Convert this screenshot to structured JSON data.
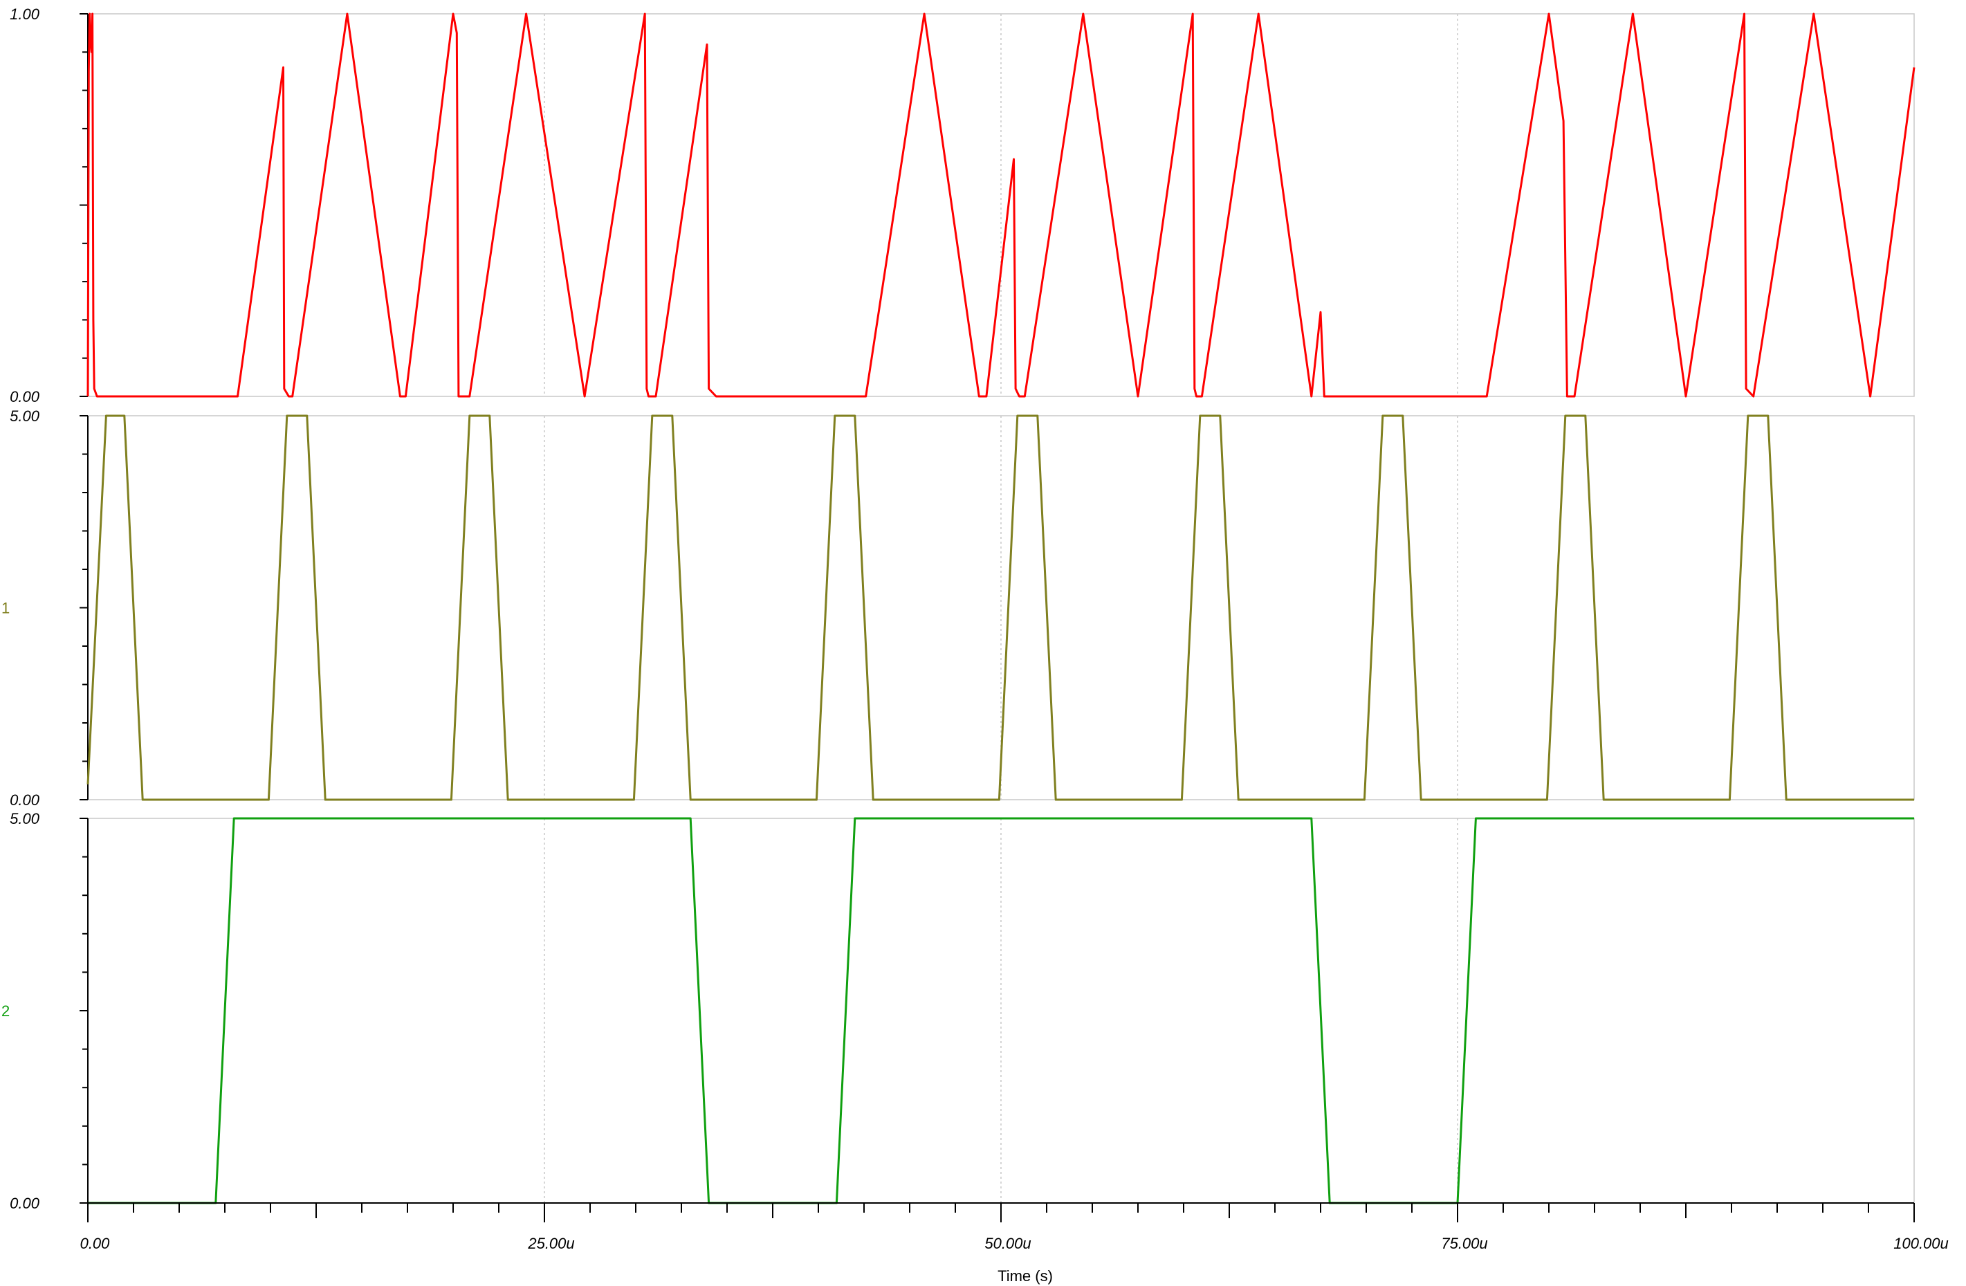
{
  "chart_data": {
    "type": "line",
    "xlabel": "Time (s)",
    "xlim": [
      0,
      100
    ],
    "x_unit": "u",
    "x_tick_labels": [
      "0.00",
      "25.00u",
      "50.00u",
      "75.00u",
      "100.00u"
    ],
    "x_ticks": [
      0,
      25,
      50,
      75,
      100
    ],
    "grid": true,
    "panels": [
      {
        "trace_label": "",
        "color": "#ff0000",
        "ylim": [
          0,
          1
        ],
        "y_tick_labels": [
          "0.00",
          "1.00"
        ],
        "series": [
          {
            "x": [
              0,
              0.05,
              0.1,
              0.15,
              0.2,
              0.25,
              0.3,
              0.35,
              0.5,
              1.0,
              5.0,
              7.5,
              8.2,
              10.7,
              10.75,
              11.0,
              11.2,
              14.2,
              17.1,
              17.4,
              20.0,
              20.2,
              20.3,
              20.6,
              20.9,
              24.0,
              27.2,
              30.5,
              30.6,
              30.7,
              31.1,
              33.9,
              34.0,
              34.4,
              37.0,
              42.0,
              42.6,
              45.8,
              48.8,
              49.2,
              50.7,
              50.8,
              51.0,
              51.3,
              54.5,
              57.5,
              60.5,
              60.6,
              60.7,
              61.0,
              64.1,
              67.0,
              67.5,
              67.7,
              67.8,
              70.0,
              75.0,
              76.6,
              80.0,
              80.8,
              81.0,
              81.4,
              84.6,
              87.5,
              90.7,
              90.8,
              91.2,
              94.5,
              97.6,
              100.0
            ],
            "y": [
              0,
              0.85,
              1,
              0.93,
              0.9,
              1,
              0.2,
              0.02,
              0,
              0,
              0,
              0,
              0,
              0.86,
              0.02,
              0,
              0,
              1,
              0,
              0,
              1,
              0.95,
              0,
              0,
              0,
              1,
              0,
              1,
              0.02,
              0,
              0,
              0.92,
              0.02,
              0,
              0,
              0,
              0,
              1,
              0,
              0,
              0.62,
              0.02,
              0,
              0,
              1,
              0,
              1,
              0.02,
              0,
              0,
              1,
              0,
              0.22,
              0,
              0,
              0,
              0,
              0,
              1,
              0.72,
              0,
              0,
              1,
              0,
              1,
              0.02,
              0,
              1,
              0,
              0.86
            ]
          }
        ]
      },
      {
        "trace_label": "1",
        "color": "#808020",
        "ylim": [
          0,
          5
        ],
        "y_tick_labels": [
          "0.00",
          "5.00"
        ],
        "series": [
          {
            "x": [
              0,
              1.0,
              2.0,
              3.0,
              9.9,
              10.9,
              12.0,
              13.0,
              19.9,
              20.9,
              22.0,
              23.0,
              29.9,
              30.9,
              32.0,
              33.0,
              39.9,
              40.9,
              42.0,
              43.0,
              49.9,
              50.9,
              52.0,
              53.0,
              59.9,
              60.9,
              62.0,
              63.0,
              69.9,
              70.9,
              72.0,
              73.0,
              79.9,
              80.9,
              82.0,
              83.0,
              89.9,
              90.9,
              92.0,
              93.0,
              100.0
            ],
            "y": [
              0.2,
              5,
              5,
              0,
              0,
              5,
              5,
              0,
              0,
              5,
              5,
              0,
              0,
              5,
              5,
              0,
              0,
              5,
              5,
              0,
              0,
              5,
              5,
              0,
              0,
              5,
              5,
              0,
              0,
              5,
              5,
              0,
              0,
              5,
              5,
              0,
              0,
              5,
              5,
              0,
              0
            ]
          }
        ]
      },
      {
        "trace_label": "2",
        "color": "#10a010",
        "ylim": [
          0,
          5
        ],
        "y_tick_labels": [
          "0.00",
          "5.00"
        ],
        "series": [
          {
            "x": [
              0,
              7.0,
              8.0,
              33.0,
              34.0,
              41.0,
              42.0,
              67.0,
              68.0,
              75.0,
              76.0,
              100.0
            ],
            "y": [
              0,
              0,
              5,
              5,
              0,
              0,
              5,
              5,
              0,
              0,
              5,
              5
            ]
          }
        ]
      }
    ]
  }
}
